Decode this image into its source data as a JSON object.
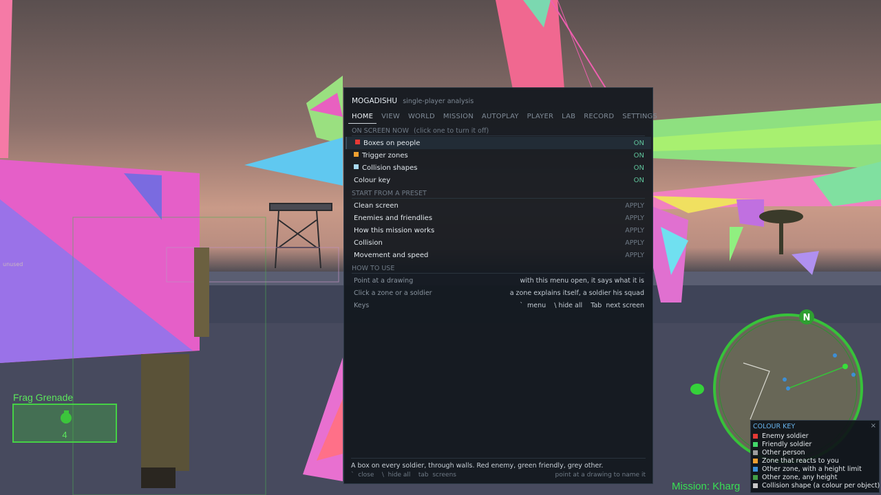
{
  "app": {
    "title": "MOGADISHU",
    "subtitle": "single-player analysis"
  },
  "tabs": [
    {
      "label": "HOME",
      "active": true
    },
    {
      "label": "VIEW"
    },
    {
      "label": "WORLD"
    },
    {
      "label": "MISSION"
    },
    {
      "label": "AUTOPLAY"
    },
    {
      "label": "PLAYER"
    },
    {
      "label": "LAB"
    },
    {
      "label": "RECORD"
    },
    {
      "label": "SETTINGS"
    }
  ],
  "on_screen": {
    "heading": "ON SCREEN NOW",
    "hint": "(click one to turn it off)",
    "items": [
      {
        "label": "Boxes on people",
        "state": "ON",
        "color": "#e53935"
      },
      {
        "label": "Trigger zones",
        "state": "ON",
        "color": "#f0a030"
      },
      {
        "label": "Collision shapes",
        "state": "ON",
        "color": "#a8d8f0"
      },
      {
        "label": "Colour key",
        "state": "ON"
      }
    ]
  },
  "presets": {
    "heading": "START FROM A PRESET",
    "items": [
      {
        "label": "Clean screen",
        "action": "APPLY"
      },
      {
        "label": "Enemies and friendlies",
        "action": "APPLY"
      },
      {
        "label": "How this mission works",
        "action": "APPLY"
      },
      {
        "label": "Collision",
        "action": "APPLY"
      },
      {
        "label": "Movement and speed",
        "action": "APPLY"
      }
    ]
  },
  "how_to": {
    "heading": "HOW TO USE",
    "items": [
      {
        "key": "Point at a drawing",
        "value": "with this menu open, it says what it is"
      },
      {
        "key": "Click a zone or a soldier",
        "value": "a zone explains itself, a soldier his squad"
      },
      {
        "key": "Keys",
        "value": "`  menu    \\ hide all    Tab  next screen"
      }
    ]
  },
  "footer": {
    "description": "A box on every soldier, through walls. Red enemy, green friendly, grey other.",
    "keys_left": "`  close    \\  hide all    tab  screens",
    "keys_right": "point at a drawing to name it"
  },
  "hud": {
    "weapon": "Frag Grenade",
    "ammo": "4",
    "mission": "Mission: Kharg",
    "unused_label": "unused",
    "compass_letter": "N"
  },
  "legend": {
    "title": "COLOUR KEY",
    "close": "×",
    "items": [
      {
        "label": "Enemy soldier",
        "color": "#e53935"
      },
      {
        "label": "Friendly soldier",
        "color": "#43d86a"
      },
      {
        "label": "Other person",
        "color": "#9e9e9e"
      },
      {
        "label": "Zone that reacts to you",
        "color": "#f0a030"
      },
      {
        "label": "Other zone, with a height limit",
        "color": "#3d8fd6"
      },
      {
        "label": "Other zone, any height",
        "color": "#43a047"
      },
      {
        "label": "Collision shape (a colour per object)",
        "color": "#c8c8c8"
      }
    ]
  }
}
